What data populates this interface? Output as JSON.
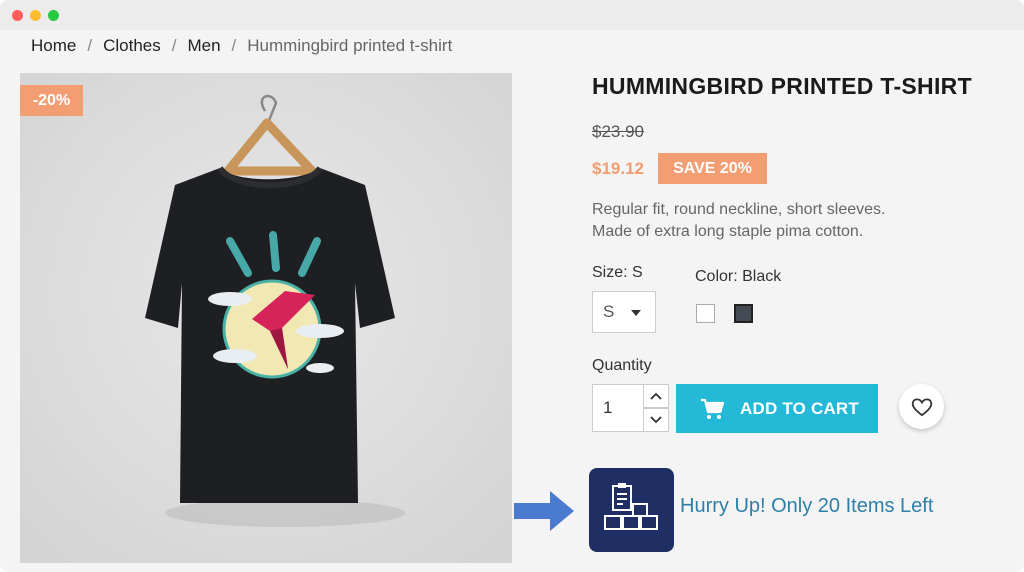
{
  "breadcrumb": {
    "items": [
      "Home",
      "Clothes",
      "Men"
    ],
    "current": "Hummingbird printed t-shirt",
    "separator": "/"
  },
  "product": {
    "discount_badge": "-20%",
    "title": "HUMMINGBIRD PRINTED T-SHIRT",
    "old_price": "$23.90",
    "new_price": "$19.12",
    "save_badge": "SAVE 20%",
    "description_line1": "Regular fit, round neckline, short sleeves.",
    "description_line2": "Made of extra long staple pima  cotton.",
    "size_label": "Size: S",
    "size_value": "S",
    "color_label": "Color: Black",
    "colors": [
      "white",
      "black"
    ],
    "quantity_label": "Quantity",
    "quantity_value": "1",
    "add_to_cart": "ADD TO CART",
    "stock_message": "Hurry Up! Only 20 Items Left"
  },
  "colors": {
    "accent": "#f39d72",
    "cart_button": "#24b9d7",
    "stock_text": "#2e80a8",
    "stock_icon_bg": "#1f2f64",
    "arrow": "#4a7bd0"
  },
  "icons": [
    "cart-icon",
    "heart-icon",
    "chevron-up-icon",
    "chevron-down-icon",
    "inventory-icon",
    "arrow-right-icon"
  ]
}
